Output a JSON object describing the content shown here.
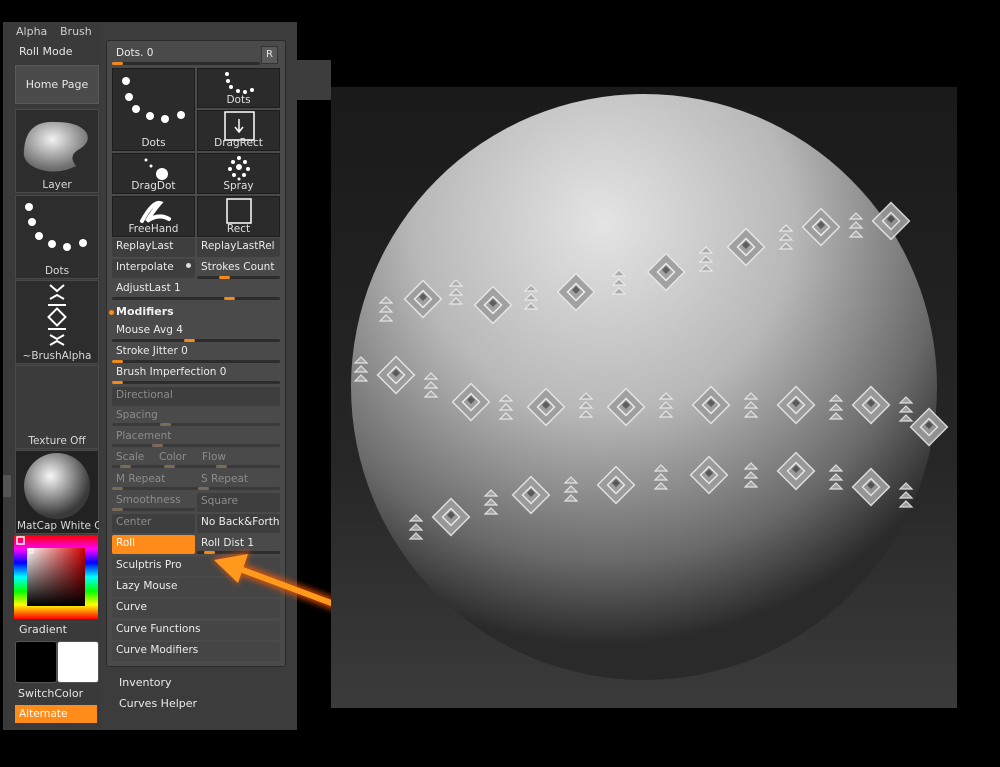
{
  "top_menu": {
    "alpha": "Alpha",
    "brush": "Brush"
  },
  "left_panel": {
    "roll_mode": "Roll Mode",
    "home_page": "Home Page",
    "brush_thumb_label": "Layer",
    "stroke_thumb_label": "Dots",
    "alpha_thumb_label": "~BrushAlpha",
    "texture_label": "Texture Off",
    "material_label": "MatCap White C",
    "gradient_label": "Gradient",
    "switch_color_label": "SwitchColor",
    "alternate_label": "Alternate",
    "colors": {
      "primary": "#000000",
      "secondary": "#ffffff"
    }
  },
  "stroke": {
    "dots_slider": {
      "label": "Dots",
      "value": "0",
      "reset": "R"
    },
    "tiles": [
      {
        "label": "Dots",
        "icon": "dots-arc-icon"
      },
      {
        "label": "Dots",
        "icon": "dots-small-icon"
      },
      {
        "label": "DragRect",
        "icon": "drag-rect-icon"
      },
      {
        "label": "DragDot",
        "icon": "drag-dot-icon"
      },
      {
        "label": "Spray",
        "icon": "spray-icon"
      },
      {
        "label": "FreeHand",
        "icon": "freehand-icon"
      },
      {
        "label": "Rect",
        "icon": "rect-icon"
      }
    ],
    "replay_last": "ReplayLast",
    "replay_last_rel": "ReplayLastRel",
    "interpolate": "Interpolate",
    "strokes_count": "Strokes Count",
    "adjust_last": {
      "label": "AdjustLast",
      "value": "1"
    },
    "modifiers": "Modifiers",
    "mouse_avg": {
      "label": "Mouse Avg",
      "value": "4"
    },
    "stroke_jitter": {
      "label": "Stroke Jitter",
      "value": "0"
    },
    "brush_imperfection": {
      "label": "Brush Imperfection",
      "value": "0"
    },
    "directional": "Directional",
    "spacing": "Spacing",
    "placement": "Placement",
    "scale": "Scale",
    "color": "Color",
    "flow": "Flow",
    "m_repeat": "M Repeat",
    "s_repeat": "S Repeat",
    "smoothness": "Smoothness",
    "square": "Square",
    "center": "Center",
    "no_back_forth": "No Back&Forth",
    "roll": "Roll",
    "roll_dist": {
      "label": "Roll Dist",
      "value": "1"
    },
    "sculptris_pro": "Sculptris Pro",
    "lazy_mouse": "Lazy Mouse",
    "curve": "Curve",
    "curve_functions": "Curve Functions",
    "curve_modifiers": "Curve Modifiers"
  },
  "below_panel": {
    "inventory": "Inventory",
    "curves_helper": "Curves Helper"
  },
  "accent_color": "#ff8c1a"
}
